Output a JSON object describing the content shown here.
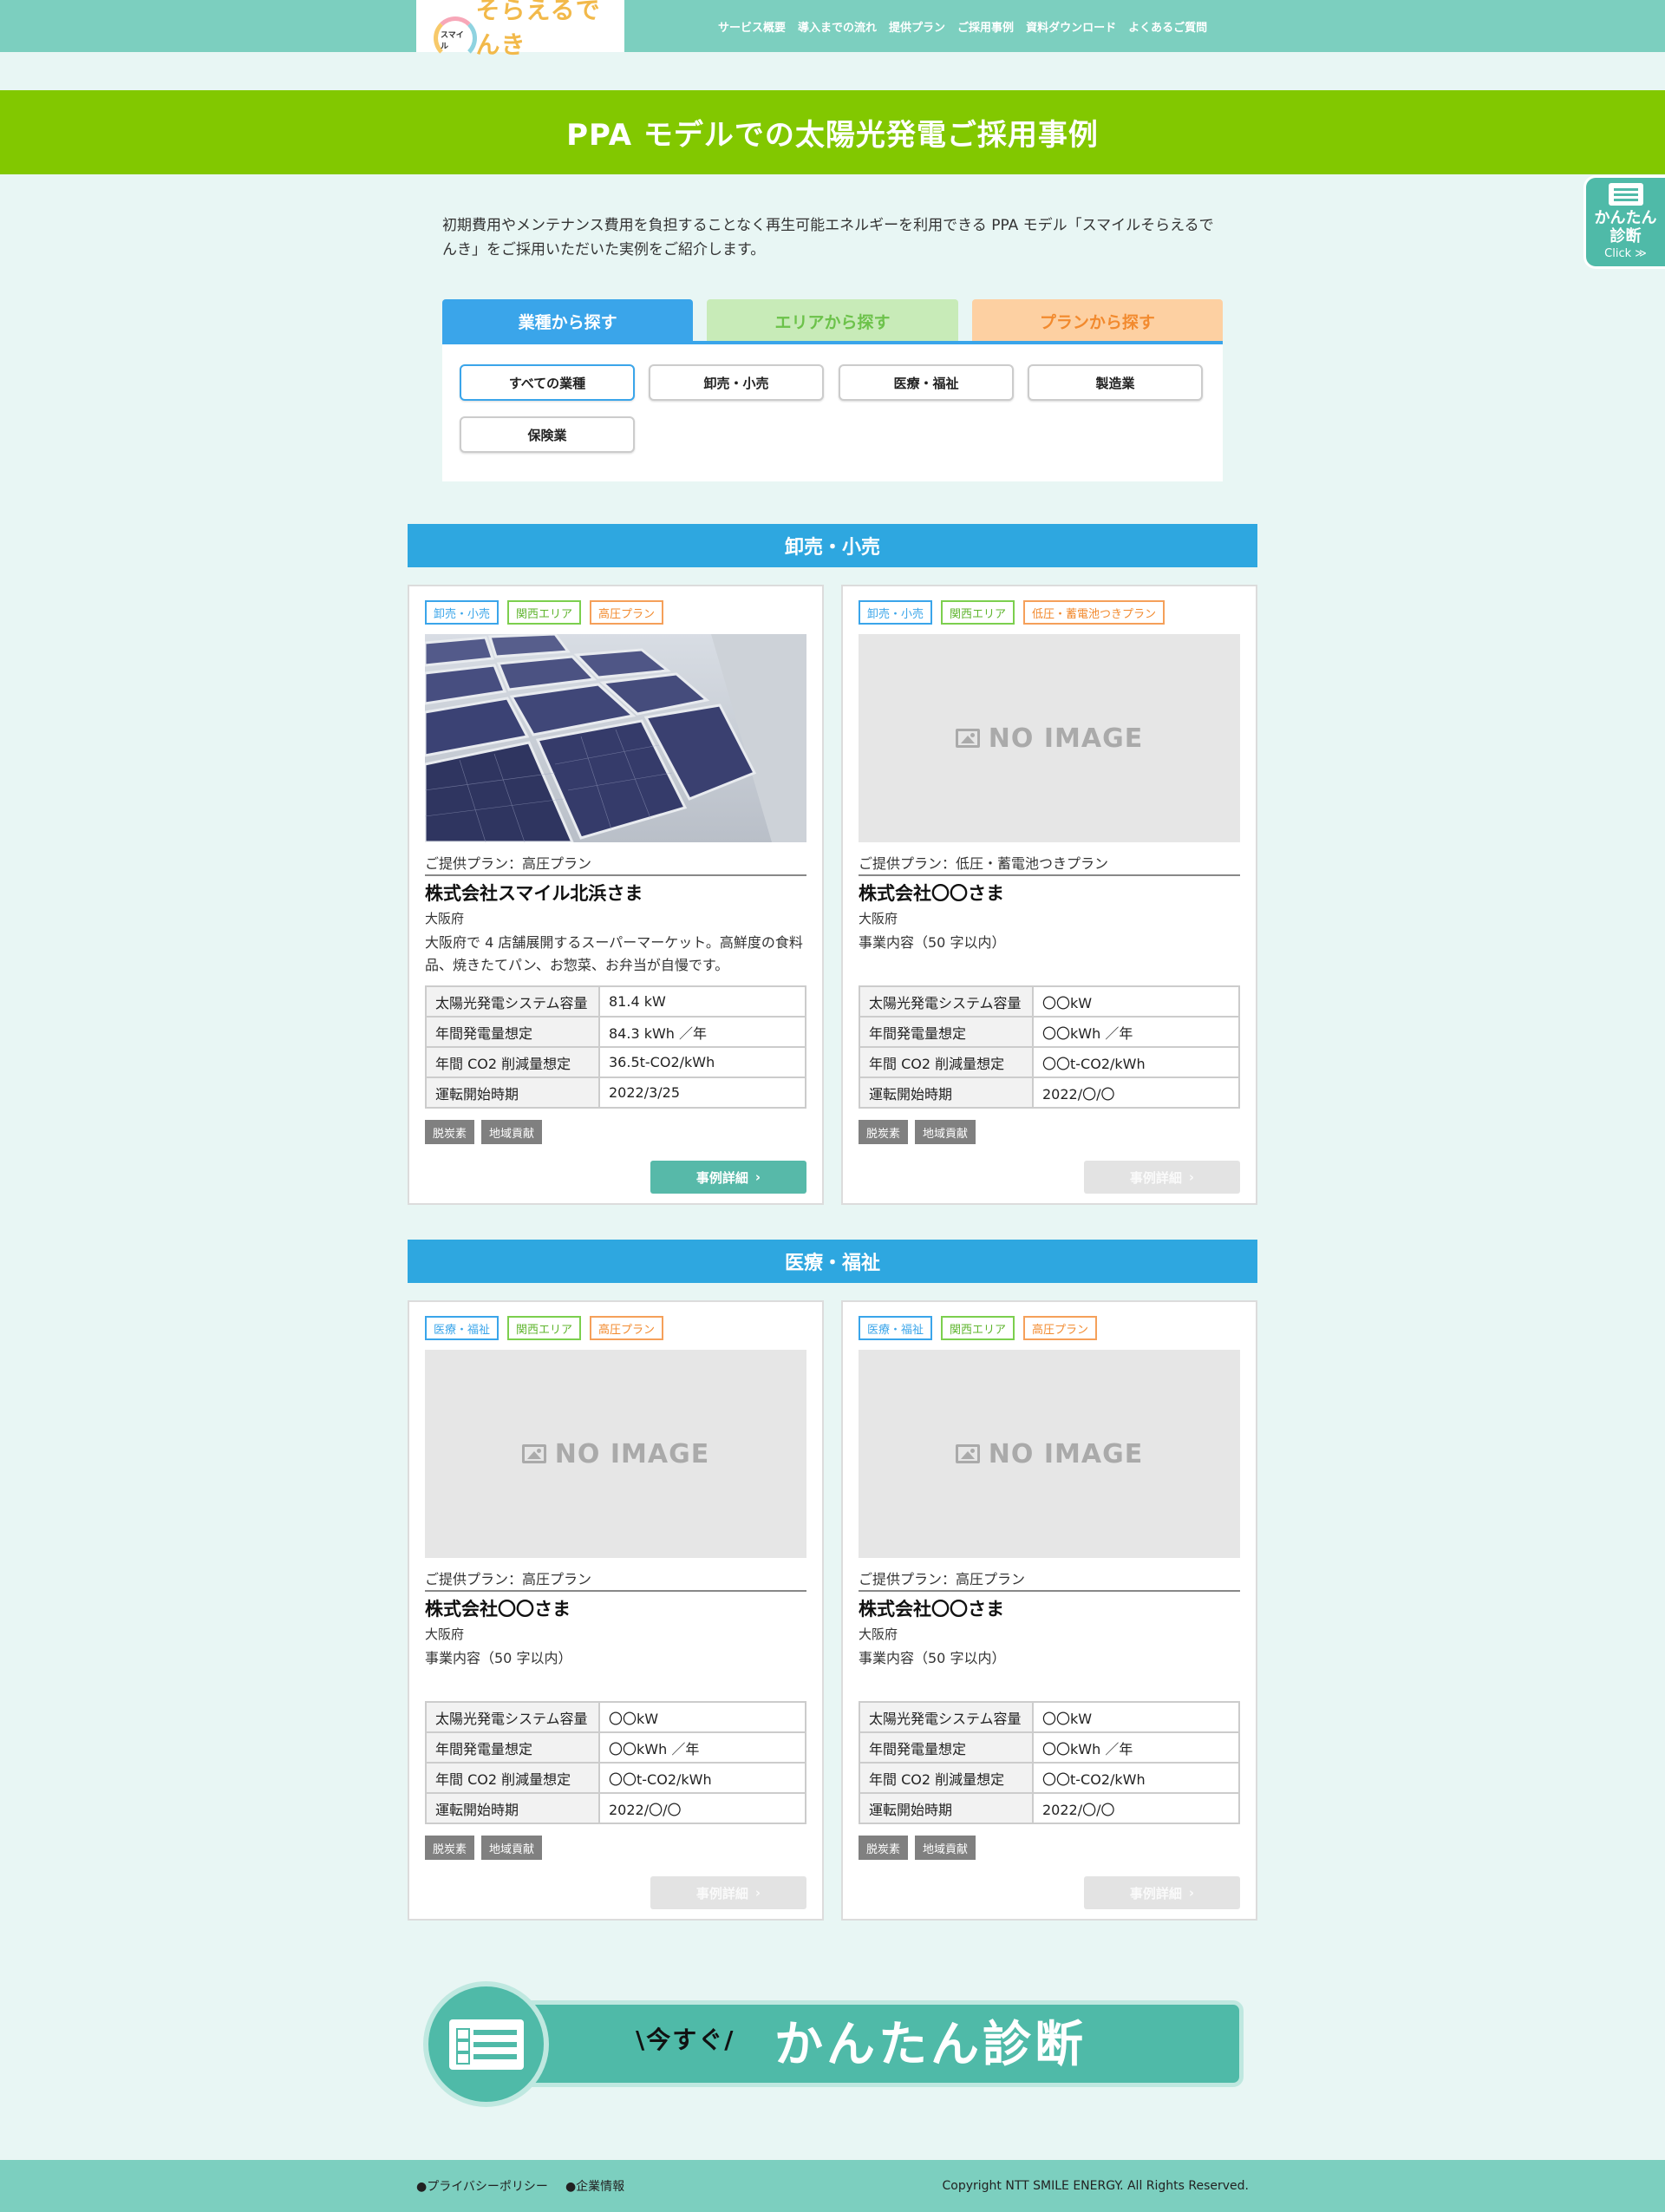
{
  "header": {
    "logo_small": "スマイル",
    "logo_text": "そらえるでんき",
    "nav": [
      "サービス概要",
      "導入までの流れ",
      "提供プラン",
      "ご採用事例",
      "資料ダウンロード",
      "よくあるご質問"
    ]
  },
  "hero": {
    "title": "PPA モデルでの太陽光発電ご採用事例"
  },
  "side_badge": {
    "line1": "かんたん",
    "line2": "診断",
    "click": "Click ≫"
  },
  "intro": "初期費用やメンテナンス費用を負担することなく再生可能エネルギーを利用できる PPA モデル「スマイルそらえるでんき」をご採用いただいた実例をご紹介します。",
  "tabs": [
    "業種から探す",
    "エリアから探す",
    "プランから探す"
  ],
  "filters": [
    "すべての業種",
    "卸売・小売",
    "医療・福祉",
    "製造業",
    "保険業"
  ],
  "spec_labels": [
    "太陽光発電システム容量",
    "年間発電量想定",
    "年間 CO2 削減量想定",
    "運転開始時期"
  ],
  "keywords": [
    "脱炭素",
    "地域貢献"
  ],
  "detail_label": "事例詳細",
  "no_image": "NO IMAGE",
  "sections": [
    {
      "title": "卸売・小売",
      "cards": [
        {
          "tags": [
            "卸売・小売",
            "関西エリア",
            "高圧プラン"
          ],
          "plan": "ご提供プラン：高圧プラン",
          "company": "株式会社スマイル北浜さま",
          "pref": "大阪府",
          "desc": "大阪府で 4 店舗展開するスーパーマーケット。高鮮度の食料品、焼きたてパン、お惣菜、お弁当が自慢です。",
          "values": [
            "81.4 kW",
            "84.3 kWh ／年",
            "36.5t-CO2/kWh",
            "2022/3/25"
          ]
        },
        {
          "tags": [
            "卸売・小売",
            "関西エリア",
            "低圧・蓄電池つきプラン"
          ],
          "plan": "ご提供プラン：低圧・蓄電池つきプラン",
          "company": "株式会社〇〇さま",
          "pref": "大阪府",
          "desc": "事業内容（50 字以内）",
          "values": [
            "〇〇kW",
            "〇〇kWh ／年",
            "〇〇t-CO2/kWh",
            "2022/〇/〇"
          ]
        }
      ]
    },
    {
      "title": "医療・福祉",
      "cards": [
        {
          "tags": [
            "医療・福祉",
            "関西エリア",
            "高圧プラン"
          ],
          "plan": "ご提供プラン：高圧プラン",
          "company": "株式会社〇〇さま",
          "pref": "大阪府",
          "desc": "事業内容（50 字以内）",
          "values": [
            "〇〇kW",
            "〇〇kWh ／年",
            "〇〇t-CO2/kWh",
            "2022/〇/〇"
          ]
        },
        {
          "tags": [
            "医療・福祉",
            "関西エリア",
            "高圧プラン"
          ],
          "plan": "ご提供プラン：高圧プラン",
          "company": "株式会社〇〇さま",
          "pref": "大阪府",
          "desc": "事業内容（50 字以内）",
          "values": [
            "〇〇kW",
            "〇〇kWh ／年",
            "〇〇t-CO2/kWh",
            "2022/〇/〇"
          ]
        }
      ]
    }
  ],
  "cta": {
    "small": "\\今すぐ/",
    "big": "かんたん診断"
  },
  "footer": {
    "links": [
      "●プライバシーポリシー",
      "●企業情報"
    ],
    "copyright": "Copyright NTT SMILE ENERGY. All Rights Reserved."
  },
  "colors": {
    "teal": "#7ccfbf",
    "green": "#82c800",
    "blue": "#2ea7e0",
    "button": "#57b9a9"
  }
}
